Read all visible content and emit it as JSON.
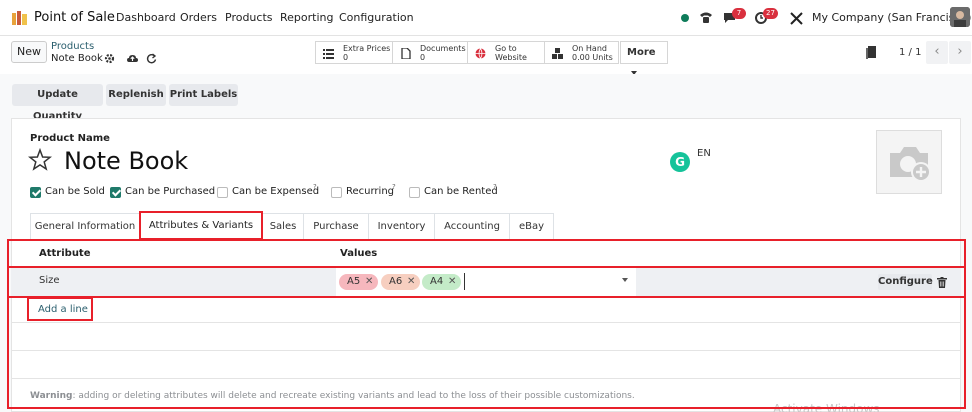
{
  "topnav": {
    "app_title": "Point of Sale",
    "menu": [
      "Dashboard",
      "Orders",
      "Products",
      "Reporting",
      "Configuration"
    ],
    "messages_count": "7",
    "activities_count": "27",
    "company": "My Company (San Francisco)"
  },
  "control": {
    "new_label": "New",
    "breadcrumb_parent": "Products",
    "breadcrumb_current": "Note Book",
    "stats": [
      {
        "line1": "Extra Prices",
        "line2": "0",
        "icon": "list-icon"
      },
      {
        "line1": "Documents",
        "line2": "0",
        "icon": "file-icon"
      },
      {
        "line1": "Go to",
        "line2": "Website",
        "icon": "globe-icon"
      },
      {
        "line1": "On Hand",
        "line2": "0.00 Units",
        "icon": "cubes-icon"
      }
    ],
    "more_label": "More",
    "pager": "1 / 1"
  },
  "actions": [
    "Update Quantity",
    "Replenish",
    "Print Labels"
  ],
  "form": {
    "product_name_label": "Product Name",
    "product_name": "Note Book",
    "lang": "EN",
    "grammarly": "G",
    "checkboxes": [
      {
        "label": "Can be Sold",
        "checked": true,
        "help": ""
      },
      {
        "label": "Can be Purchased",
        "checked": true,
        "help": ""
      },
      {
        "label": "Can be Expensed",
        "checked": false,
        "help": "?"
      },
      {
        "label": "Recurring",
        "checked": false,
        "help": "?"
      },
      {
        "label": "Can be Rented",
        "checked": false,
        "help": "?"
      }
    ]
  },
  "tabs": [
    "General Information",
    "Attributes & Variants",
    "Sales",
    "Purchase",
    "Inventory",
    "Accounting",
    "eBay"
  ],
  "active_tab": "Attributes & Variants",
  "table": {
    "col_attribute": "Attribute",
    "col_values": "Values",
    "rows": [
      {
        "attribute": "Size",
        "values": [
          "A5",
          "A6",
          "A4"
        ],
        "configure_label": "Configure"
      }
    ],
    "add_line_label": "Add a line"
  },
  "tag_colors": {
    "A5": "#f6b7bd",
    "A6": "#f7cfc0",
    "A4": "#c4ebc8"
  },
  "warning_bold": "Warning",
  "warning_text": ": adding or deleting attributes will delete and recreate existing variants and lead to the loss of their possible customizations.",
  "watermark": "Activate Windows"
}
